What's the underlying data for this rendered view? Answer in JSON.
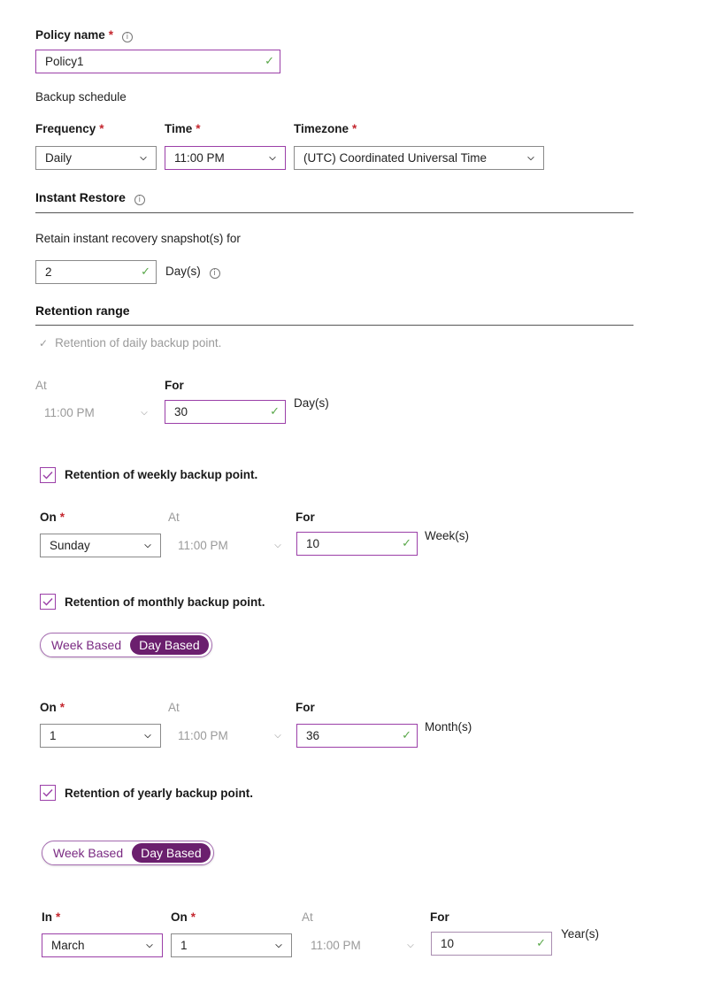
{
  "policy": {
    "name_label": "Policy name",
    "required_mark": "*",
    "name_value": "Policy1"
  },
  "backup_schedule": {
    "heading": "Backup schedule",
    "frequency_label": "Frequency",
    "frequency_value": "Daily",
    "time_label": "Time",
    "time_value": "11:00 PM",
    "timezone_label": "Timezone",
    "timezone_value": "(UTC) Coordinated Universal Time"
  },
  "instant_restore": {
    "heading": "Instant Restore",
    "retain_label": "Retain instant recovery snapshot(s) for",
    "retain_value": "2",
    "unit": "Day(s)"
  },
  "retention_range": {
    "heading": "Retention range",
    "daily": {
      "label": "Retention of daily backup point.",
      "at_label": "At",
      "at_value": "11:00 PM",
      "for_label": "For",
      "for_value": "30",
      "unit": "Day(s)"
    },
    "weekly": {
      "label": "Retention of weekly backup point.",
      "checked": true,
      "on_label": "On",
      "on_value": "Sunday",
      "at_label": "At",
      "at_value": "11:00 PM",
      "for_label": "For",
      "for_value": "10",
      "unit": "Week(s)"
    },
    "monthly": {
      "label": "Retention of monthly backup point.",
      "checked": true,
      "toggle_options": [
        "Week Based",
        "Day Based"
      ],
      "toggle_selected": "Day Based",
      "on_label": "On",
      "on_value": "1",
      "at_label": "At",
      "at_value": "11:00 PM",
      "for_label": "For",
      "for_value": "36",
      "unit": "Month(s)"
    },
    "yearly": {
      "label": "Retention of yearly backup point.",
      "checked": true,
      "toggle_options": [
        "Week Based",
        "Day Based"
      ],
      "toggle_selected": "Day Based",
      "in_label": "In",
      "in_value": "March",
      "on_label": "On",
      "on_value": "1",
      "at_label": "At",
      "at_value": "11:00 PM",
      "for_label": "For",
      "for_value": "10",
      "unit": "Year(s)"
    }
  },
  "colors": {
    "accent_purple": "#9b3fa8",
    "toggle_selected_bg": "#6b1f6e",
    "required_red": "#c4262e",
    "valid_check_green": "#5aa84a"
  },
  "icons": {
    "info": "info-icon",
    "valid": "checkmark-icon",
    "dropdown": "chevron-down-icon",
    "checkbox": "checkbox-checked-icon"
  }
}
